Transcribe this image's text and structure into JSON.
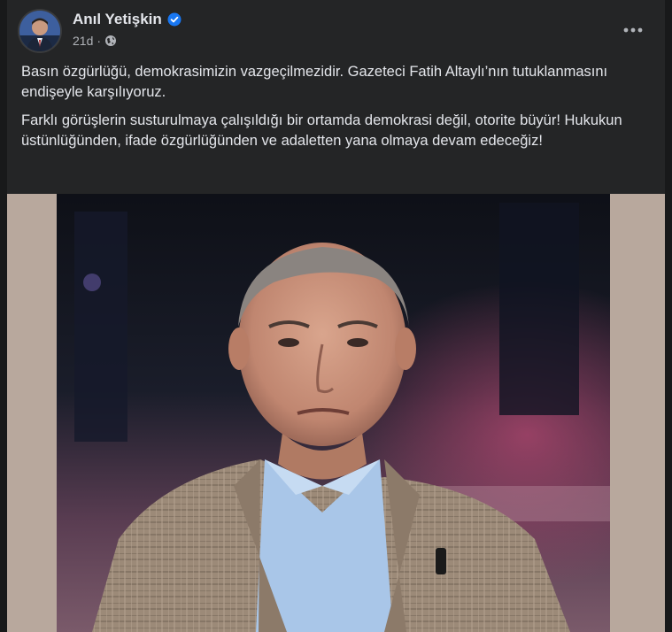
{
  "post": {
    "author_name": "Anıl Yetişkin",
    "timestamp": "21d",
    "separator": "·",
    "more_icon": "more-horizontal-icon",
    "verified_icon": "verified-badge-icon",
    "audience_icon": "globe-icon",
    "paragraphs": [
      "Basın özgürlüğü, demokrasimizin vazgeçilmezidir. Gazeteci Fatih Altaylı’nın tutuklanmasını endişeyle karşılıyoruz.",
      "Farklı görüşlerin susturulmaya çalışıldığı bir ortamda demokrasi değil, otorite büyür! Hukukun üstünlüğünden, ifade özgürlüğünden ve adaletten yana olmaya devam edeceğiz!"
    ]
  },
  "colors": {
    "card_bg": "#242526",
    "text_primary": "#e4e6eb",
    "text_secondary": "#b0b3b8",
    "verified_blue": "#1877f2",
    "media_side_bg": "#b8a89d"
  }
}
